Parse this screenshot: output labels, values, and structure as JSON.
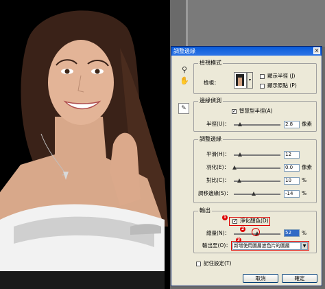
{
  "dialog": {
    "title": "調整邊緣",
    "close": "×"
  },
  "view_mode": {
    "group_title": "檢視模式",
    "view_label": "檢視：",
    "show_radius_label": "顯示半徑 (J)",
    "show_original_label": "顯示原點 (P)"
  },
  "edge_detection": {
    "group_title": "邊緣偵測",
    "smart_radius_label": "智慧型半徑(A)",
    "radius_label": "半徑(U)：",
    "radius_value": "2.8",
    "radius_unit": "像素"
  },
  "adjust_edge": {
    "group_title": "調整邊緣",
    "smooth_label": "平滑(H)：",
    "smooth_value": "12",
    "feather_label": "羽化(E)：",
    "feather_value": "0.0",
    "feather_unit": "像素",
    "contrast_label": "對比(C)：",
    "contrast_value": "10",
    "contrast_unit": "%",
    "shift_label": "調移邊緣(S)：",
    "shift_value": "-14",
    "shift_unit": "%"
  },
  "output": {
    "group_title": "輸出",
    "decontaminate_label": "淨化顏色(D)",
    "amount_label": "總量(N)：",
    "amount_value": "52",
    "amount_unit": "%",
    "output_to_label": "輸出至(O)：",
    "output_to_value": "新增使用圖層遮色片的圖層"
  },
  "remember_label": "記住設定(T)",
  "cancel_label": "取消",
  "ok_label": "確定",
  "markers": [
    "1",
    "2",
    "3"
  ],
  "sliders": {
    "radius": 0.12,
    "smooth": 0.12,
    "feather": 0.0,
    "contrast": 0.1,
    "shift": 0.43,
    "amount": 0.5
  }
}
